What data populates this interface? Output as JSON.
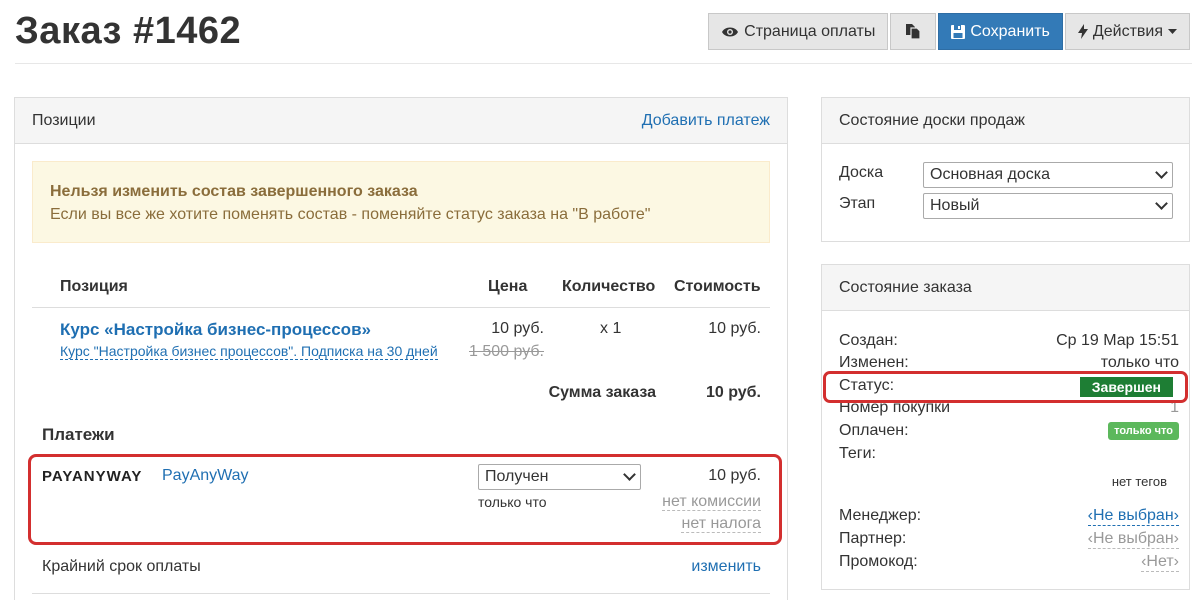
{
  "page": {
    "title": "Заказ #1462"
  },
  "toolbar": {
    "payment_page": "Страница оплаты",
    "save": "Сохранить",
    "actions": "Действия"
  },
  "positions": {
    "header": "Позиции",
    "add_payment": "Добавить платеж",
    "alert_title": "Нельзя изменить состав завершенного заказа",
    "alert_text": "Если вы все же хотите поменять состав - поменяйте статус заказа на \"В работе\"",
    "columns": {
      "position": "Позиция",
      "price": "Цена",
      "quantity": "Количество",
      "cost": "Стоимость"
    },
    "item": {
      "title": "Курс «Настройка бизнес-процессов»",
      "subtitle": "Курс \"Настройка бизнес процессов\". Подписка на 30 дней",
      "price": "10 руб.",
      "old_price": "1 500 руб.",
      "quantity": "x 1",
      "cost": "10 руб."
    },
    "sum_label": "Сумма заказа",
    "sum_value": "10 руб."
  },
  "payments": {
    "header": "Платежи",
    "logo_text": "PAYANYWAY",
    "provider": "PayAnyWay",
    "status_selected": "Получен",
    "time": "только что",
    "amount": "10 руб.",
    "commission": "нет комиссии",
    "tax": "нет налога"
  },
  "deadline": {
    "label": "Крайний срок оплаты",
    "change": "изменить"
  },
  "board": {
    "header": "Состояние доски продаж",
    "board_label": "Доска",
    "board_value": "Основная доска",
    "stage_label": "Этап",
    "stage_value": "Новый"
  },
  "order_state": {
    "header": "Состояние заказа",
    "created_label": "Создан:",
    "created_value": "Ср 19 Мар 15:51",
    "changed_label": "Изменен:",
    "changed_value": "только что",
    "status_label": "Статус:",
    "status_value": "Завершен",
    "purchase_label": "Номер покупки",
    "purchase_value": "1",
    "paid_label": "Оплачен:",
    "paid_value": "только что",
    "tags_label": "Теги:",
    "tags_value": "нет тегов",
    "manager_label": "Менеджер:",
    "manager_value": "‹Не выбран›",
    "partner_label": "Партнер:",
    "partner_value": "‹Не выбран›",
    "promo_label": "Промокод:",
    "promo_value": "‹Нет›"
  },
  "colors": {
    "primary": "#337ab7",
    "link": "#1f6fb2",
    "status_green": "#1e7e34",
    "badge_green": "#5cb85c",
    "highlight_red": "#d32f2f"
  },
  "icons": [
    "eye-icon",
    "copy-icon",
    "save-icon",
    "bolt-icon",
    "caret-down-icon"
  ]
}
